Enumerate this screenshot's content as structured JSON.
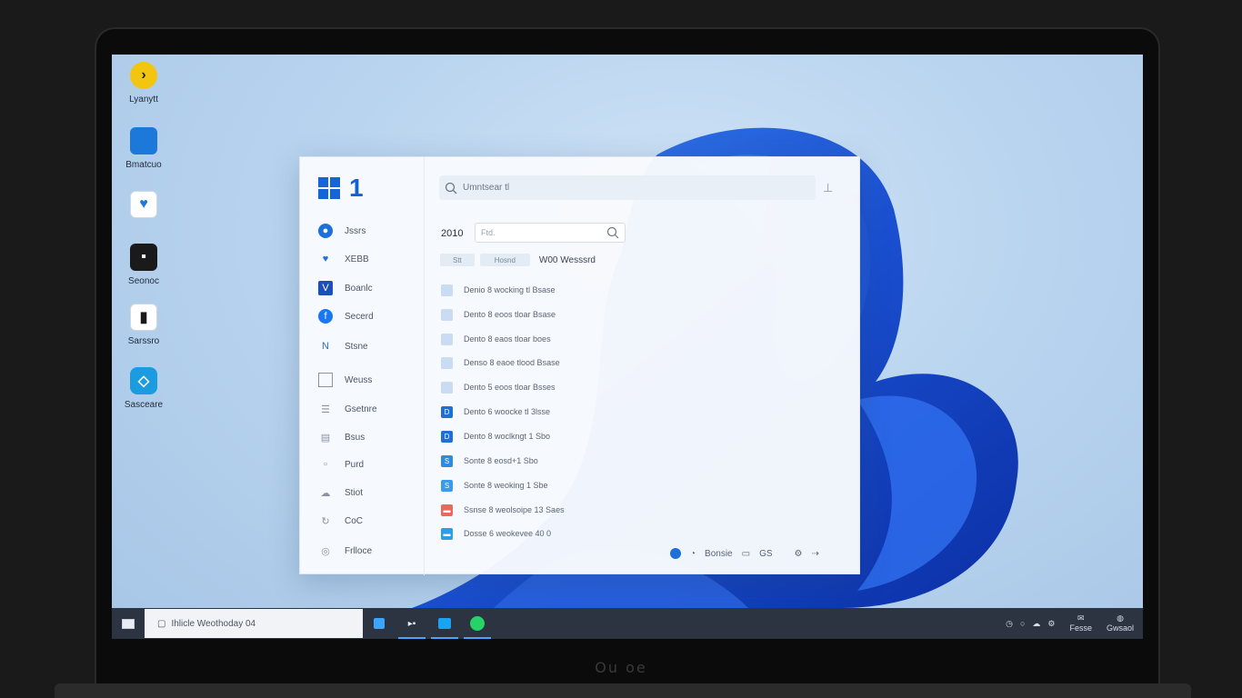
{
  "desktop": {
    "icons": [
      {
        "label": "Lyanytt",
        "name": "desktop-icon-1",
        "color": "#f2c511"
      },
      {
        "label": "Bmatcuo",
        "name": "desktop-icon-2",
        "color": "#1c79d9"
      },
      {
        "label": "",
        "name": "desktop-icon-3",
        "color": "#ffffff"
      },
      {
        "label": "Seonoc",
        "name": "desktop-icon-4",
        "color": "#1a1a1a"
      },
      {
        "label": "Sarssro",
        "name": "desktop-icon-5",
        "color": "#ffffff"
      },
      {
        "label": "Sasceare",
        "name": "desktop-icon-6",
        "color": "#1b9be0"
      }
    ]
  },
  "start": {
    "logo_number": "1",
    "nav": [
      {
        "label": "Jssrs"
      },
      {
        "label": "XEBB"
      },
      {
        "label": "Boanlc"
      },
      {
        "label": "Secerd"
      },
      {
        "label": "Stsne"
      },
      {
        "label": "Weuss"
      },
      {
        "label": "Gsetnre"
      },
      {
        "label": "Bsus"
      },
      {
        "label": "Purd"
      },
      {
        "label": "Stiot"
      },
      {
        "label": "CoC"
      },
      {
        "label": "Frlloce"
      }
    ],
    "search_placeholder": "Umntsear tl",
    "year": "2010",
    "filter_placeholder": "Ftd.",
    "chips": [
      "Stt",
      "Hosnd"
    ],
    "section_title": "W00 Wesssrd",
    "rows": [
      {
        "label": "Denio 8 wocking tl Bsase",
        "color": "#c9dcf3"
      },
      {
        "label": "Dento 8 eoos tloar Bsase",
        "color": "#c9dcf3"
      },
      {
        "label": "Dento 8 eaos tloar boes",
        "color": "#c9dcf3"
      },
      {
        "label": "Denso 8 eaoe tlood Bsase",
        "color": "#c9dcf3"
      },
      {
        "label": "Dento 5 eoos tloar Bsses",
        "color": "#c9dcf3"
      },
      {
        "label": "Dento 6 woocke tl 3lsse",
        "color": "#1f6fd6"
      },
      {
        "label": "Dento 8 woclkngt 1 Sbo",
        "color": "#1f6fd6"
      },
      {
        "label": "Sonte 8 eosd+1 Sbo",
        "color": "#2e8be3"
      },
      {
        "label": "Sonte 8 weoking 1 Sbe",
        "color": "#3a9be8"
      },
      {
        "label": "Ssnse 8 weolsoipe 13 Saes",
        "color": "#e86a5a"
      },
      {
        "label": "Dosse 6 weokevee 40 0",
        "color": "#2b9fe6"
      }
    ],
    "bottom_label": "Bonsie",
    "bottom_label_2": "GS"
  },
  "taskbar": {
    "search_text": "Ihlicle Weothoday 04",
    "tray_items": [
      "Fesse",
      "Gwsaol"
    ],
    "accent": "#4aa3ff"
  }
}
